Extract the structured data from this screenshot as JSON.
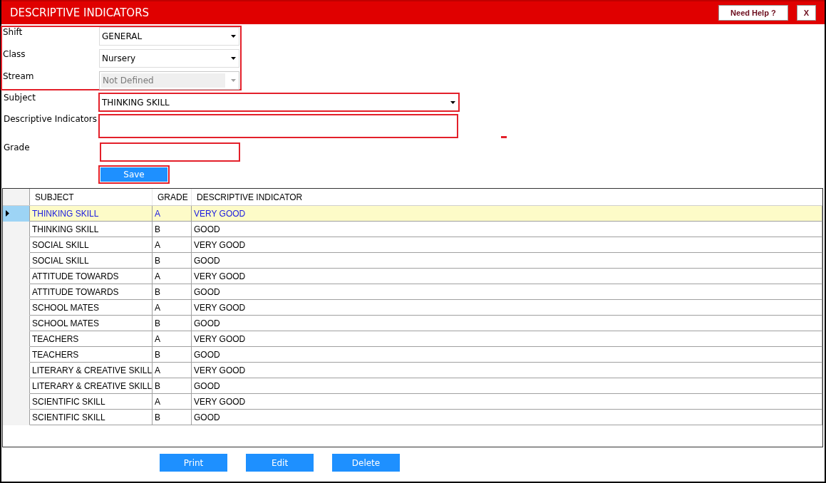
{
  "window": {
    "title": "DESCRIPTIVE INDICATORS",
    "help_button": "Need Help ?",
    "close_button": "X"
  },
  "class_group": [
    {
      "label": "Shift",
      "value": "GENERAL",
      "disabled": false
    },
    {
      "label": "Class",
      "value": "Nursery",
      "disabled": false
    },
    {
      "label": "Stream",
      "value": "Not Defined",
      "disabled": true
    }
  ],
  "subject": {
    "label": "Subject",
    "value": "THINKING SKILL"
  },
  "descriptive_indicators": {
    "label": "Descriptive Indicators"
  },
  "grade": {
    "label": "Grade"
  },
  "save_button": "Save",
  "table": {
    "columns": [
      "SUBJECT",
      "GRADE",
      "DESCRIPTIVE INDICATOR"
    ],
    "rows": [
      {
        "cells": [
          "THINKING SKILL",
          "A",
          "VERY GOOD"
        ],
        "selected": true
      },
      {
        "cells": [
          "THINKING SKILL",
          "B",
          "GOOD"
        ],
        "selected": false
      },
      {
        "cells": [
          "SOCIAL SKILL",
          "A",
          "VERY GOOD"
        ],
        "selected": false
      },
      {
        "cells": [
          "SOCIAL SKILL",
          "B",
          "GOOD"
        ],
        "selected": false
      },
      {
        "cells": [
          "ATTITUDE TOWARDS",
          "A",
          "VERY GOOD"
        ],
        "selected": false
      },
      {
        "cells": [
          "ATTITUDE TOWARDS",
          "B",
          "GOOD"
        ],
        "selected": false
      },
      {
        "cells": [
          "SCHOOL MATES",
          "A",
          "VERY GOOD"
        ],
        "selected": false
      },
      {
        "cells": [
          "SCHOOL MATES",
          "B",
          "GOOD"
        ],
        "selected": false
      },
      {
        "cells": [
          "TEACHERS",
          "A",
          "VERY GOOD"
        ],
        "selected": false
      },
      {
        "cells": [
          "TEACHERS",
          "B",
          "GOOD"
        ],
        "selected": false
      },
      {
        "cells": [
          "LITERARY & CREATIVE SKILL",
          "A",
          "VERY GOOD"
        ],
        "selected": false
      },
      {
        "cells": [
          "LITERARY & CREATIVE SKILL",
          "B",
          "GOOD"
        ],
        "selected": false
      },
      {
        "cells": [
          "SCIENTIFIC SKILL",
          "A",
          "VERY GOOD"
        ],
        "selected": false
      },
      {
        "cells": [
          "SCIENTIFIC SKILL",
          "B",
          "GOOD"
        ],
        "selected": false
      }
    ]
  },
  "action_buttons": [
    "Print",
    "Edit",
    "Delete"
  ]
}
